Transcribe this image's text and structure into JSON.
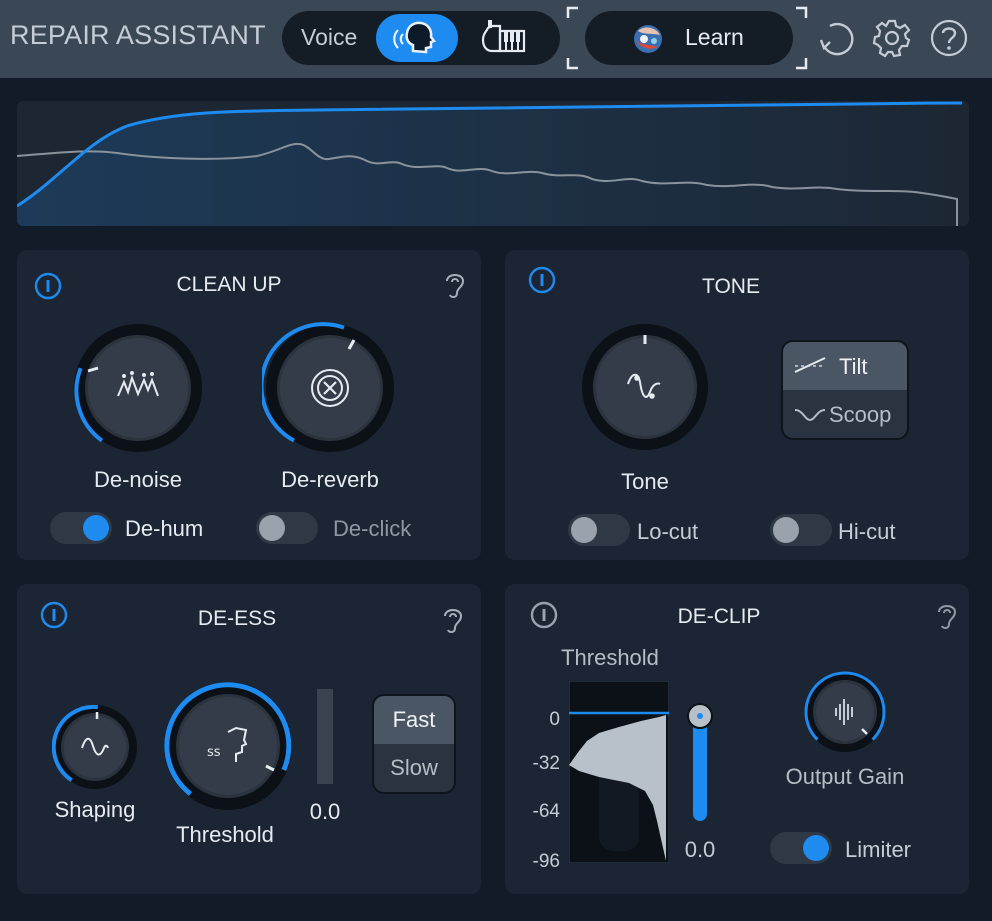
{
  "header": {
    "title": "REPAIR ASSISTANT",
    "mode_voice_label": "Voice",
    "learn_label": "Learn",
    "icons": [
      "voice-head-icon",
      "music-instrument-icon",
      "learn-orb-icon",
      "undo-icon",
      "gear-icon",
      "help-icon"
    ]
  },
  "colors": {
    "accent": "#1d8bf0",
    "panel": "#1c2533",
    "background": "#121c28",
    "header": "#3a4856"
  },
  "clean_up": {
    "title": "CLEAN UP",
    "denoise_label": "De-noise",
    "denoise_value": 0.3,
    "dereverb_label": "De-reverb",
    "dereverb_value": 0.55,
    "dehum_label": "De-hum",
    "dehum_on": true,
    "declick_label": "De-click",
    "declick_on": false
  },
  "tone": {
    "title": "TONE",
    "tone_label": "Tone",
    "tilt_label": "Tilt",
    "scoop_label": "Scoop",
    "selected_mode": "Tilt",
    "locut_label": "Lo-cut",
    "locut_on": false,
    "hicut_label": "Hi-cut",
    "hicut_on": false
  },
  "de_ess": {
    "title": "DE-ESS",
    "shaping_label": "Shaping",
    "threshold_label": "Threshold",
    "meter_value": "0.0",
    "fast_label": "Fast",
    "slow_label": "Slow",
    "selected_speed": "Fast"
  },
  "de_clip": {
    "title": "DE-CLIP",
    "threshold_label": "Threshold",
    "scale": [
      "0",
      "-32",
      "-64",
      "-96"
    ],
    "threshold_value": "0.0",
    "output_gain_label": "Output Gain",
    "limiter_label": "Limiter",
    "limiter_on": true
  }
}
